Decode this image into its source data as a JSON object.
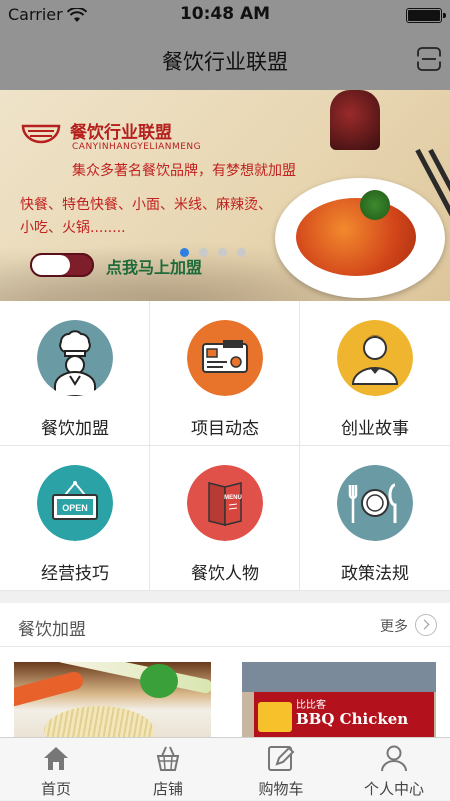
{
  "status_bar": {
    "carrier": "Carrier",
    "time": "10:48 AM"
  },
  "navbar": {
    "title": "餐饮行业联盟",
    "scan_icon": "scan-icon"
  },
  "banner": {
    "brand": "餐饮行业联盟",
    "pinyin": "CANYINHANGYELIANMENG",
    "line1": "集众多著名餐饮品牌，有梦想就加盟",
    "line2": "快餐、特色快餐、小面、米线、麻辣烫、",
    "line3": "小吃、火锅........",
    "cta": "点我马上加盟",
    "carousel": {
      "count": 4,
      "active_index": 0
    }
  },
  "grid": {
    "items": [
      {
        "label": "餐饮加盟",
        "icon": "chef-icon",
        "color": "#6a9aa3"
      },
      {
        "label": "项目动态",
        "icon": "bank-card-icon",
        "color": "#e8732b"
      },
      {
        "label": "创业故事",
        "icon": "businessman-icon",
        "color": "#f0b52e"
      },
      {
        "label": "经营技巧",
        "icon": "open-sign-icon",
        "color": "#2aa2a6"
      },
      {
        "label": "餐饮人物",
        "icon": "menu-icon",
        "color": "#e0514a"
      },
      {
        "label": "政策法规",
        "icon": "dining-plate-icon",
        "color": "#6a9aa3"
      }
    ]
  },
  "section": {
    "title": "餐饮加盟",
    "more": "更多",
    "cards": [
      {
        "image": "noodles-vegetables"
      },
      {
        "image": "bbq-chicken-storefront",
        "sign_small": "比比客",
        "sign_text": "BBQ Chicken"
      }
    ]
  },
  "tabbar": {
    "tabs": [
      {
        "label": "首页",
        "icon": "home-icon",
        "active": true
      },
      {
        "label": "店铺",
        "icon": "basket-icon",
        "active": false
      },
      {
        "label": "购物车",
        "icon": "edit-icon",
        "active": false
      },
      {
        "label": "个人中心",
        "icon": "user-icon",
        "active": false
      }
    ]
  }
}
